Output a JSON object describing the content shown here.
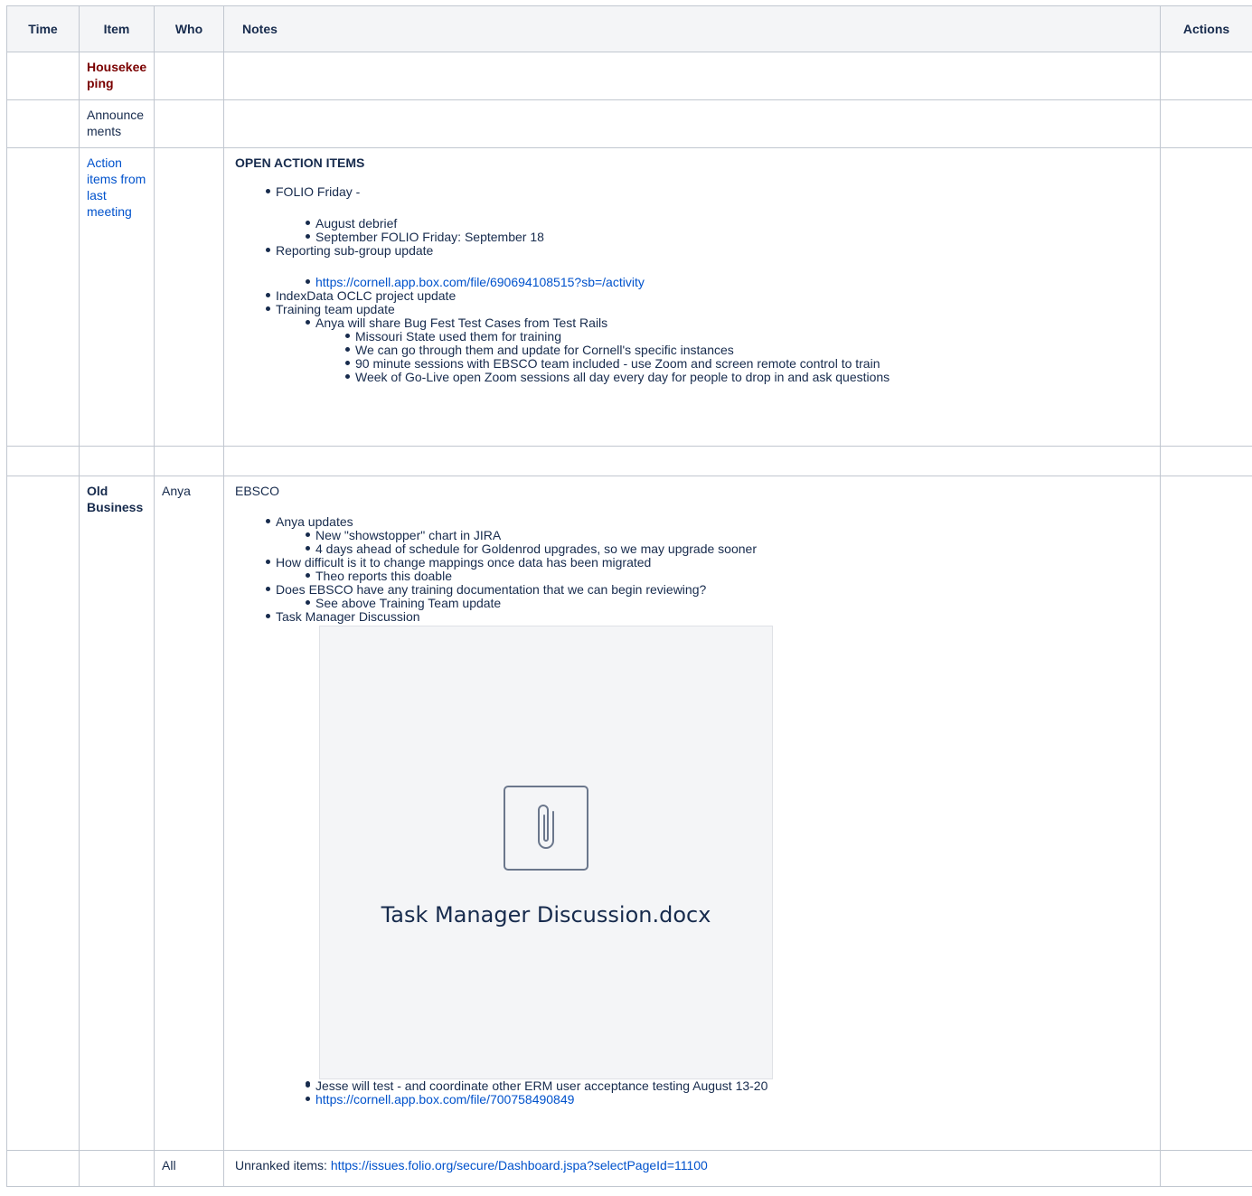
{
  "headers": {
    "time": "Time",
    "item": "Item",
    "who": "Who",
    "notes": "Notes",
    "actions": "Actions"
  },
  "rows": {
    "housekeeping": {
      "item": "Housekeeping"
    },
    "announcements": {
      "item": "Announcements"
    },
    "action_items": {
      "item": "Action items from last meeting",
      "heading": "OPEN ACTION ITEMS",
      "folio_friday": "FOLIO Friday -",
      "august_debrief": "August debrief",
      "september": "September FOLIO Friday: September 18",
      "reporting": "Reporting sub-group update",
      "reporting_link": "https://cornell.app.box.com/file/690694108515?sb=/activity",
      "indexdata": "IndexData OCLC project update",
      "training": "Training team update",
      "anya_share": "Anya will share Bug Fest Test Cases from Test Rails",
      "missouri": "Missouri State used them for training",
      "go_through": "We can go through them and update for Cornell's specific instances",
      "sessions": "90 minute sessions with EBSCO team included - use Zoom and screen remote control to train",
      "week_golive": "Week of Go-Live open Zoom sessions all day every day for people to drop in and ask questions"
    },
    "old_business": {
      "item": "Old Business",
      "who": "Anya",
      "ebsco": "EBSCO",
      "anya_updates": "Anya updates",
      "showstopper": "New \"showstopper\" chart in JIRA",
      "four_days": "4 days ahead of schedule for Goldenrod upgrades, so we may upgrade sooner",
      "how_difficult": "How difficult is it to change mappings once data has been migrated",
      "theo": "Theo reports this doable",
      "does_ebsco": "Does EBSCO have any training documentation that we can begin reviewing?",
      "see_above": "See above Training Team update",
      "task_manager": "Task Manager Discussion",
      "attachment_name": "Task Manager Discussion.docx",
      "jesse": "Jesse will test - and coordinate other ERM user acceptance testing August 13-20",
      "box_link": "https://cornell.app.box.com/file/700758490849"
    },
    "unranked": {
      "who": "All",
      "label": "Unranked items: ",
      "link": "https://issues.folio.org/secure/Dashboard.jspa?selectPageId=11100"
    }
  },
  "colors": {
    "housekeeping": "#7a0000",
    "link": "#0052cc",
    "border": "#c1c7d0",
    "header_bg": "#f4f5f7"
  },
  "icons": {
    "attachment": "paperclip-icon"
  }
}
